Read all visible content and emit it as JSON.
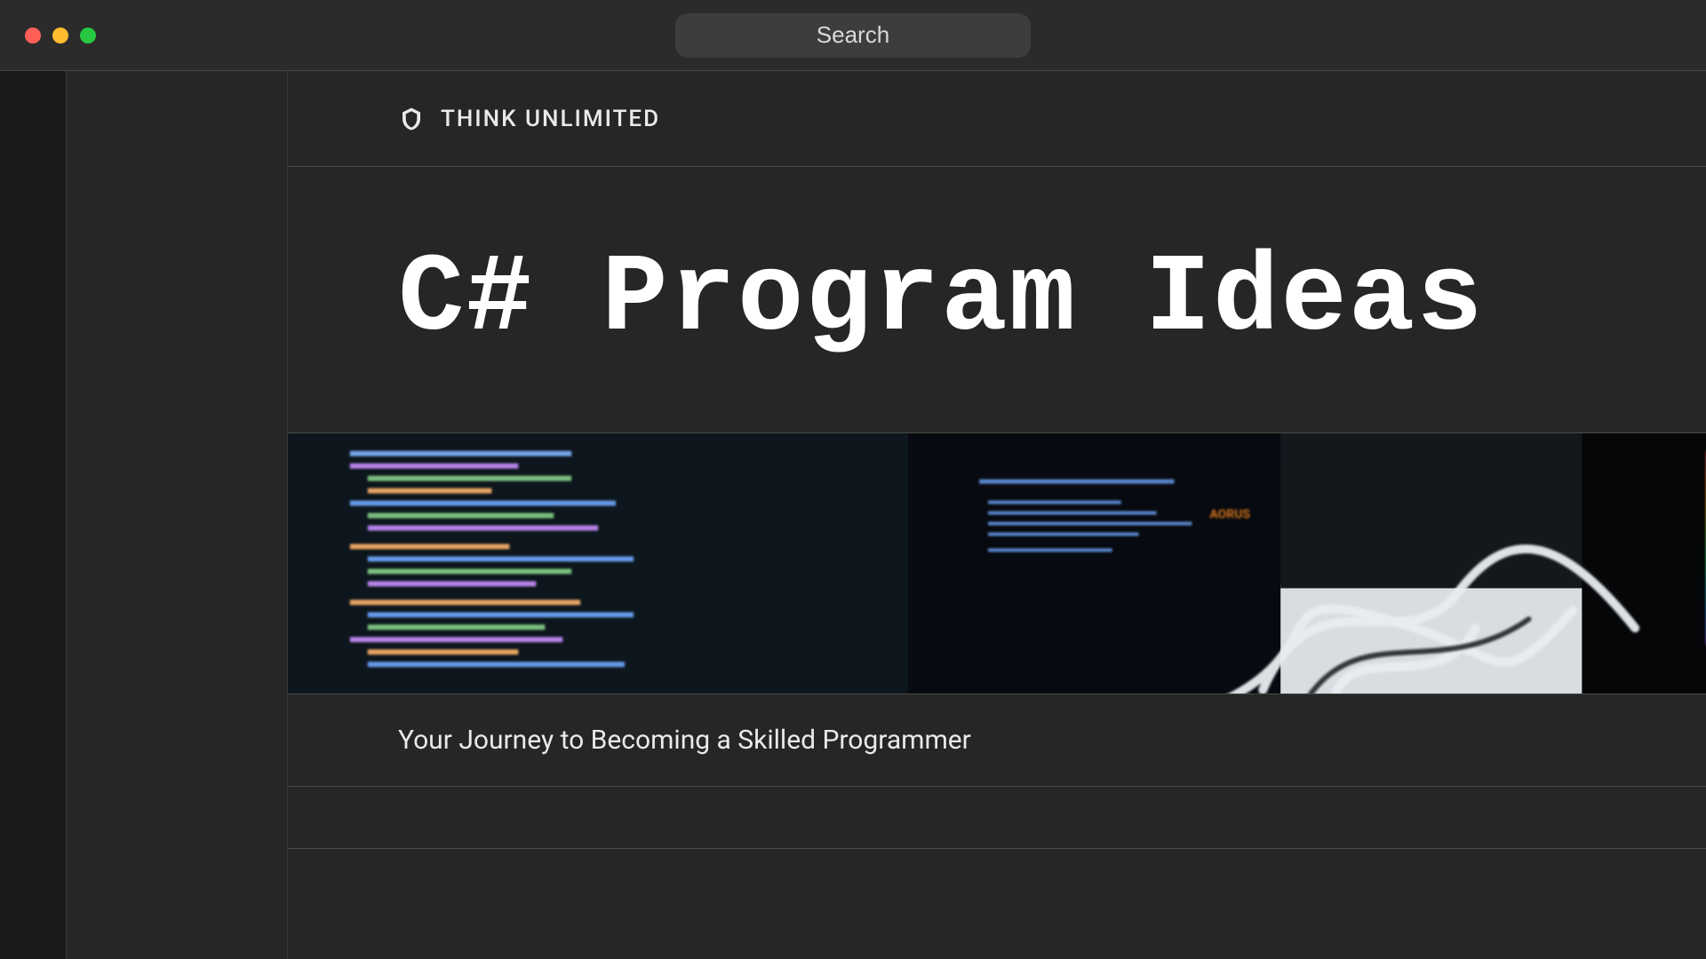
{
  "titlebar": {
    "search_placeholder": "Search"
  },
  "brand": {
    "name": "THINK UNLIMITED"
  },
  "hero": {
    "title": "C# Program Ideas",
    "subtitle": "Your Journey to Becoming a Skilled Programmer",
    "image_alt": "Photograph of a laptop displaying source code next to a desktop PC with RGB lighting and tangled cables"
  }
}
